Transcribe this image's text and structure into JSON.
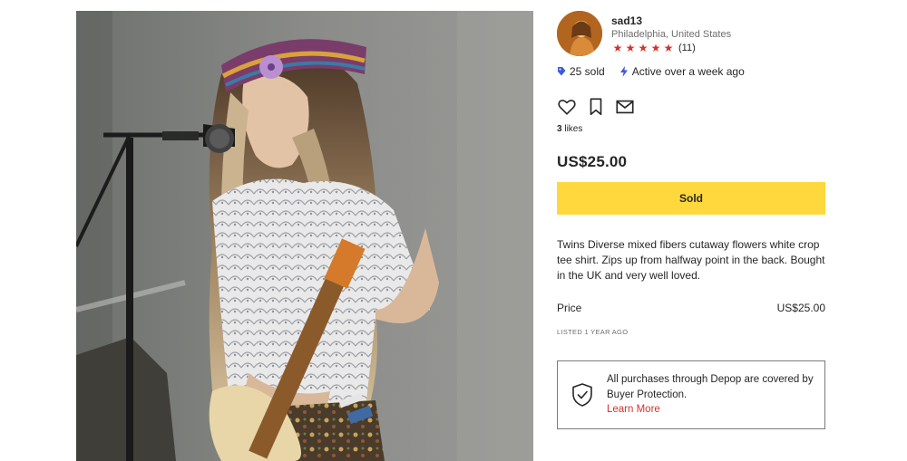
{
  "seller": {
    "username": "sad13",
    "location": "Philadelphia, United States",
    "rating_stars": 5,
    "review_count": "(11)"
  },
  "stats": {
    "sold": "25 sold",
    "active": "Active over a week ago"
  },
  "likes": {
    "count": "3",
    "label": "likes"
  },
  "price": "US$25.00",
  "sold_button_label": "Sold",
  "description": "Twins Diverse mixed fibers cutaway flowers white crop tee shirt. Zips up from halfway point in the back. Bought in the UK and very well loved.",
  "price_row": {
    "label": "Price",
    "value": "US$25.00"
  },
  "listed": "LISTED 1 YEAR AGO",
  "protection": {
    "text": "All purchases through Depop are covered by Buyer Protection.",
    "link": "Learn More"
  },
  "colors": {
    "accent_yellow": "#fed83c",
    "star_red": "#d8302a",
    "link_red": "#d8302a",
    "tag_blue": "#3b5bdb"
  },
  "icons": {
    "heart": "heart-icon",
    "bookmark": "bookmark-icon",
    "share": "envelope-icon",
    "shield": "shield-check-icon",
    "tag": "tag-icon",
    "bolt": "lightning-icon"
  }
}
